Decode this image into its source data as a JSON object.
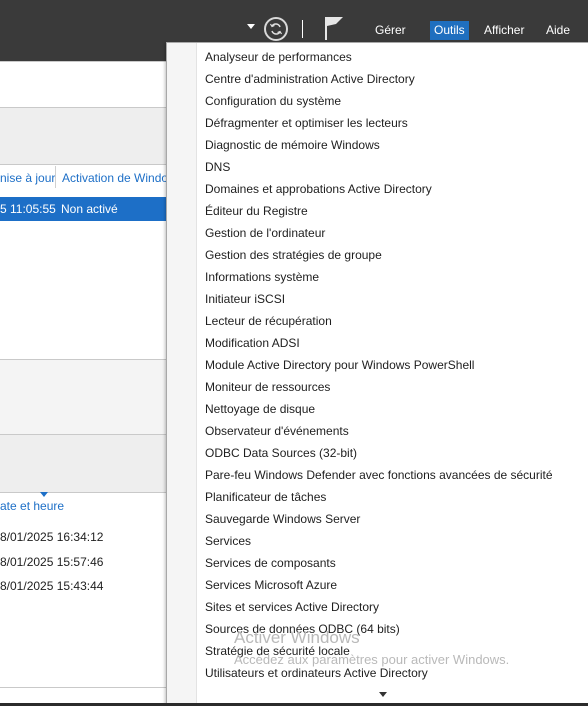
{
  "toolbar": {
    "menus": [
      {
        "label": "Gérer"
      },
      {
        "label": "Outils"
      },
      {
        "label": "Afficher"
      },
      {
        "label": "Aide"
      }
    ]
  },
  "background": {
    "col_header_update": "nise à jour",
    "col_header_activation": "Activation de Windo",
    "row_time": "5 11:05:55",
    "row_activation": "Non activé",
    "col_header_datetime": "ate et heure",
    "events": [
      "8/01/2025 16:34:12",
      "8/01/2025 15:57:46",
      "8/01/2025 15:43:44"
    ]
  },
  "tools_menu": {
    "items": [
      "Analyseur de performances",
      "Centre d'administration Active Directory",
      "Configuration du système",
      "Défragmenter et optimiser les lecteurs",
      "Diagnostic de mémoire Windows",
      "DNS",
      "Domaines et approbations Active Directory",
      "Éditeur du Registre",
      "Gestion de l'ordinateur",
      "Gestion des stratégies de groupe",
      "Informations système",
      "Initiateur iSCSI",
      "Lecteur de récupération",
      "Modification ADSI",
      "Module Active Directory pour Windows PowerShell",
      "Moniteur de ressources",
      "Nettoyage de disque",
      "Observateur d'événements",
      "ODBC Data Sources (32-bit)",
      "Pare-feu Windows Defender avec fonctions avancées de sécurité",
      "Planificateur de tâches",
      "Sauvegarde Windows Server",
      "Services",
      "Services de composants",
      "Services Microsoft Azure",
      "Sites et services Active Directory",
      "Sources de données ODBC (64 bits)",
      "Stratégie de sécurité locale",
      "Utilisateurs et ordinateurs Active Directory"
    ]
  },
  "watermark": {
    "title": "Activer Windows",
    "subtitle": "Accédez aux paramètres pour activer Windows."
  },
  "icons": {
    "refresh": "refresh-icon",
    "flag": "flag-icon",
    "dropdown": "chevron-down-icon",
    "scroll_down": "scroll-down-icon"
  },
  "colors": {
    "topbar": "#3a3a3a",
    "accent": "#1f6fbf",
    "selection": "#1d6fc7"
  }
}
